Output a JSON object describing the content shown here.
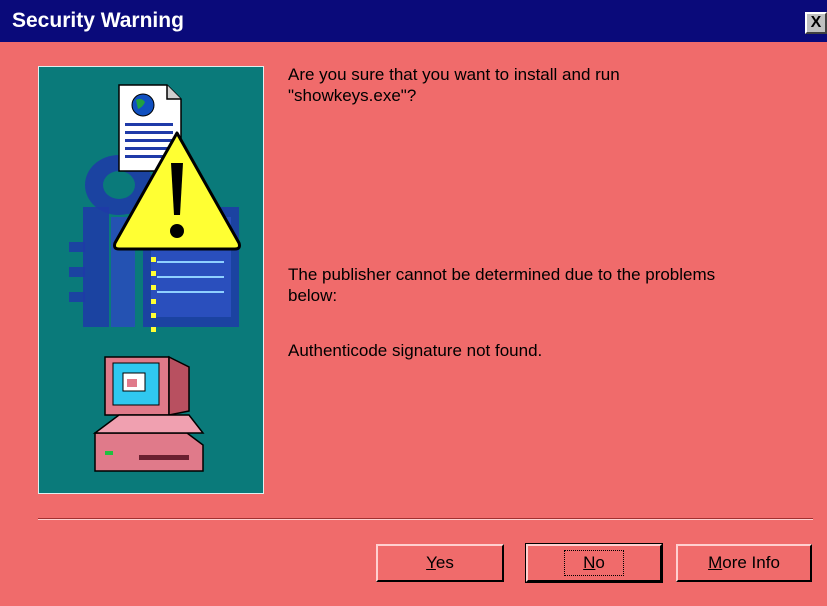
{
  "window": {
    "title": "Security Warning",
    "close_glyph": "X"
  },
  "message": {
    "line1": "Are you sure that you want to install and run",
    "line2": "\"showkeys.exe\"?",
    "publisher_line1": "The publisher cannot be determined due to the problems",
    "publisher_line2": "below:",
    "signature": "Authenticode signature not found."
  },
  "buttons": {
    "yes": {
      "mnemonic": "Y",
      "rest": "es"
    },
    "no": {
      "mnemonic": "N",
      "rest": "o"
    },
    "more_info": {
      "mnemonic": "M",
      "rest": "ore Info"
    }
  },
  "art": {
    "icons": [
      "document-globe-icon",
      "warning-icon",
      "keys-icon",
      "certificate-icon",
      "computer-icon"
    ]
  },
  "colors": {
    "dialog_bg": "#f06b6b",
    "title_bar": "#0a0a7a",
    "art_bg": "#0a7a7a",
    "warning_yellow": "#ffff33"
  }
}
